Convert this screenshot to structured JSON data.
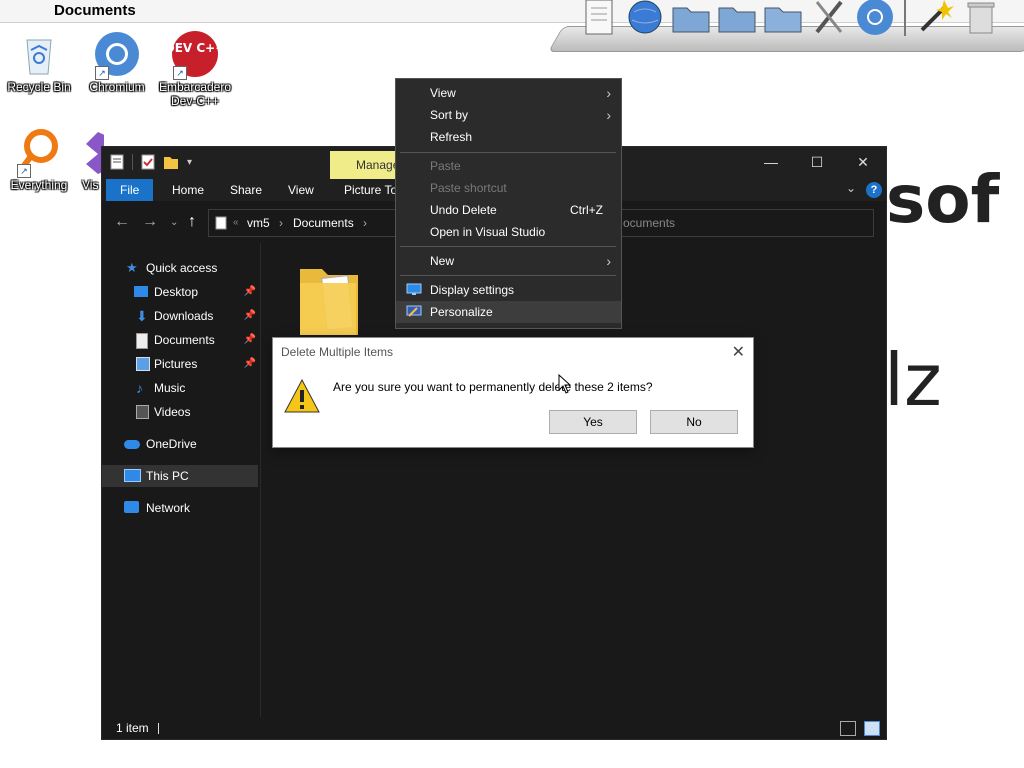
{
  "menubar": {
    "title": "Documents"
  },
  "desktop_icons": [
    {
      "label": "Recycle Bin"
    },
    {
      "label": "Chromium"
    },
    {
      "label": "Embarcadero Dev-C++"
    },
    {
      "label": "Everything"
    },
    {
      "label": "Vis"
    }
  ],
  "dev_badge": "DEV C++",
  "background_text": {
    "line1": "sof",
    "line2": "lz"
  },
  "explorer": {
    "manage_tab": "Manage",
    "ribbon_tabs": [
      "File",
      "Home",
      "Share",
      "View",
      "Picture To"
    ],
    "address_path": [
      "vm5",
      "Documents"
    ],
    "search_placeholder": "ocuments",
    "nav": {
      "quick_access": "Quick access",
      "desktop": "Desktop",
      "downloads": "Downloads",
      "documents": "Documents",
      "pictures": "Pictures",
      "music": "Music",
      "videos": "Videos",
      "onedrive": "OneDrive",
      "this_pc": "This PC",
      "network": "Network"
    },
    "status": "1 item"
  },
  "context_menu": {
    "view": "View",
    "sort_by": "Sort by",
    "refresh": "Refresh",
    "paste": "Paste",
    "paste_shortcut": "Paste shortcut",
    "undo_delete": "Undo Delete",
    "undo_shortcut": "Ctrl+Z",
    "open_vs": "Open in Visual Studio",
    "new": "New",
    "display_settings": "Display settings",
    "personalize": "Personalize"
  },
  "dialog": {
    "title": "Delete Multiple Items",
    "message": "Are you sure you want to permanently delete these 2 items?",
    "yes": "Yes",
    "no": "No"
  },
  "colors": {
    "explorer_bg": "#191919",
    "file_tab": "#1a73c8",
    "manage_tab": "#f1ec8a"
  }
}
